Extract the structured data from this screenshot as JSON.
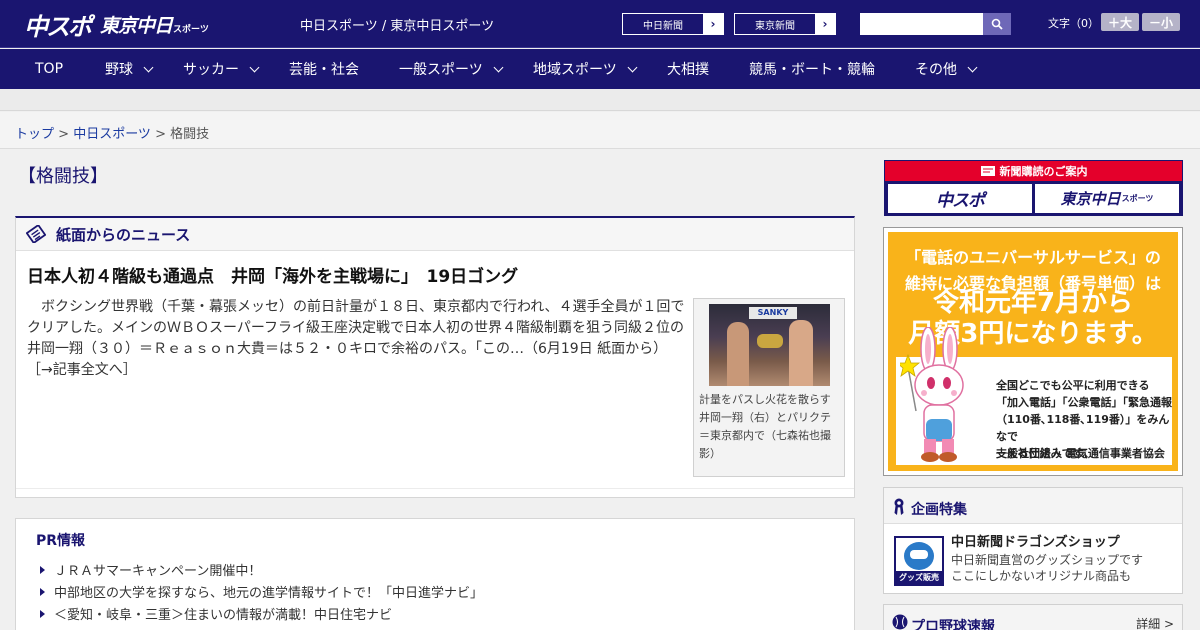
{
  "header": {
    "logo_chunichi": "中スポ",
    "logo_tokyo": "東京中日",
    "logo_tokyo_small": "スポーツ",
    "site_link": "中日スポーツ / 東京中日スポーツ",
    "ext_links": [
      {
        "label": "中日新聞"
      },
      {
        "label": "東京新聞"
      }
    ],
    "search_placeholder": "",
    "font_size_label": "文字（0）",
    "font_bigger": "＋大",
    "font_smaller": "－小"
  },
  "nav": {
    "items": [
      {
        "label": "TOP",
        "dropdown": false
      },
      {
        "label": "野球",
        "dropdown": true
      },
      {
        "label": "サッカー",
        "dropdown": true
      },
      {
        "label": "芸能・社会",
        "dropdown": false
      },
      {
        "label": "一般スポーツ",
        "dropdown": true
      },
      {
        "label": "地域スポーツ",
        "dropdown": true
      },
      {
        "label": "大相撲",
        "dropdown": false
      },
      {
        "label": "競馬・ボート・競輪",
        "dropdown": false
      },
      {
        "label": "その他",
        "dropdown": true
      }
    ]
  },
  "breadcrumb": {
    "home": "トップ",
    "sep1": " > ",
    "section": "中日スポーツ",
    "sep2": " > ",
    "current": "格闘技"
  },
  "page_title": "【格闘技】",
  "news": {
    "section_title": "紙面からのニュース",
    "article_title": "日本人初４階級も通過点　井岡「海外を主戦場に」　19日ゴング",
    "article_body": "ボクシング世界戦（千葉・幕張メッセ）の前日計量が１８日、東京都内で行われ、４選手全員が１回でクリアした。メインのＷＢＯスーパーフライ級王座決定戦で日本人初の世界４階級制覇を狙う同級２位の井岡一翔（３０）＝Ｒｅａｓｏｎ大貴＝は５２・０キロで余裕のパス。「この…（6月19日 紙面から）",
    "more_link": "［→記事全文へ］",
    "photo_banner": "SANKY",
    "photo_caption": "計量をパスし火花を散らす井岡一翔（右）とパリクテ＝東京都内で（七森祐也撮影）"
  },
  "pr": {
    "title": "PR情報",
    "items": [
      "ＪＲＡサマーキャンペーン開催中！",
      "中部地区の大学を探すなら、地元の進学情報サイトで！「中日進学ナビ」",
      "＜愛知・岐阜・三重＞住まいの情報が満載！中日住宅ナビ"
    ]
  },
  "sidebar": {
    "subscribe_header": "新聞購読のご案内",
    "subscribe_a": "中スポ",
    "subscribe_b": "東京中日",
    "subscribe_b_small": "スポーツ",
    "universal_ad": {
      "line1": "「電話のユニバーサルサービス」の",
      "line2": "維持に必要な負担額（番号単価）は",
      "big1": "令和元年7月から",
      "big2": "月額3円になります。",
      "text1": "全国どこでも公平に利用できる",
      "text2": "「加入電話」「公衆電話」「緊急通報",
      "text3": "（110番､118番､119番）」をみんなで",
      "text4": "支える仕組みです。",
      "org": "一般社団法人 電気通信事業者協会"
    },
    "feature": {
      "title": "企画特集",
      "shop_name": "中日新聞ドラゴンズショップ",
      "shop_desc1": "中日新聞直営のグッズショップです",
      "shop_desc2": "ここにしかないオリジナル商品も",
      "shop_tag": "グッズ販売中"
    },
    "baseball": {
      "title": "プロ野球速報",
      "detail": "詳細 >"
    }
  },
  "colors": {
    "navy": "#1a1570",
    "accent_red": "#e4002b",
    "ad_orange": "#f9b31a"
  }
}
